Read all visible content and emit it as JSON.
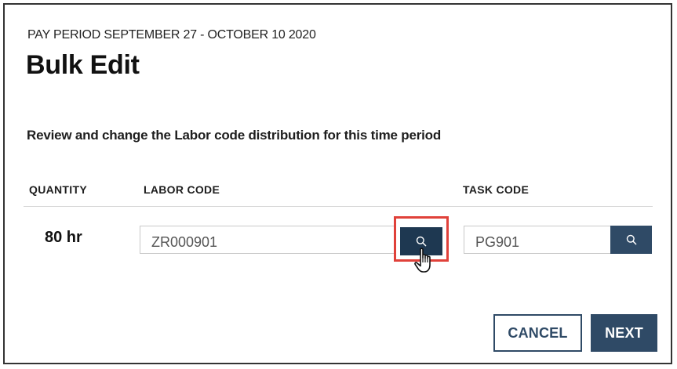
{
  "dialog": {
    "eyebrow": "PAY PERIOD SEPTEMBER 27 - OCTOBER 10 2020",
    "title": "Bulk Edit",
    "instructions": "Review and change the Labor code distribution for this time period"
  },
  "table": {
    "headers": {
      "quantity": "QUANTITY",
      "labor_code": "LABOR CODE",
      "task_code": "TASK CODE"
    },
    "row": {
      "quantity": "80 hr",
      "labor_code": "ZR000901",
      "task_code": "PG901"
    }
  },
  "icons": {
    "labor_search": "search-icon",
    "task_search": "search-icon",
    "cursor": "hand-pointer-icon"
  },
  "buttons": {
    "cancel": "CANCEL",
    "next": "NEXT"
  },
  "colors": {
    "primary": "#2f4a66",
    "primary_dark": "#1e3851",
    "highlight": "#e0413a"
  }
}
